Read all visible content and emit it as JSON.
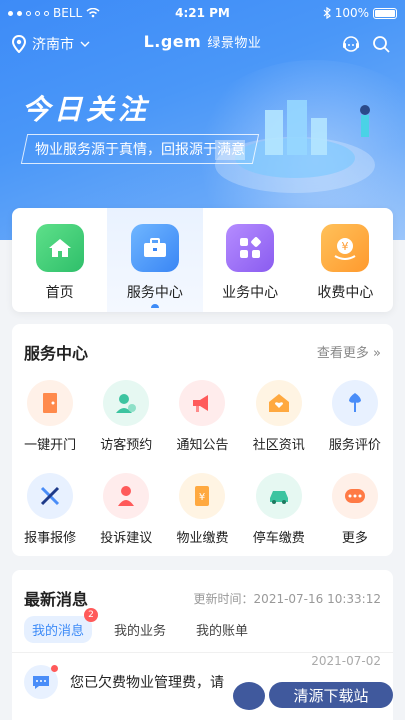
{
  "status": {
    "carrier": "BELL",
    "time": "4:21 PM",
    "battery": "100%"
  },
  "nav": {
    "city": "济南市",
    "logo_main": "L.gem",
    "logo_sub": "绿景物业"
  },
  "hero": {
    "title": "今日关注",
    "slogan": "物业服务源于真情，回报源于满意"
  },
  "tabs": [
    {
      "label": "首页",
      "icon": "home-icon",
      "active": false
    },
    {
      "label": "服务中心",
      "icon": "briefcase-icon",
      "active": true
    },
    {
      "label": "业务中心",
      "icon": "grid-icon",
      "active": false
    },
    {
      "label": "收费中心",
      "icon": "yuan-bag-icon",
      "active": false
    }
  ],
  "services": {
    "title": "服务中心",
    "more": "查看更多 »",
    "items": [
      {
        "label": "一键开门",
        "icon": "door-icon",
        "color": "#ff8a4c"
      },
      {
        "label": "访客预约",
        "icon": "visitor-icon",
        "color": "#3cc4a0"
      },
      {
        "label": "通知公告",
        "icon": "megaphone-icon",
        "color": "#ff5a5a"
      },
      {
        "label": "社区资讯",
        "icon": "house-heart-icon",
        "color": "#ffa940"
      },
      {
        "label": "服务评价",
        "icon": "flower-icon",
        "color": "#4a8df8"
      },
      {
        "label": "报事报修",
        "icon": "wrench-icon",
        "color": "#4a8df8"
      },
      {
        "label": "投诉建议",
        "icon": "complaint-icon",
        "color": "#ff5a5a"
      },
      {
        "label": "物业缴费",
        "icon": "bill-icon",
        "color": "#ffa940"
      },
      {
        "label": "停车缴费",
        "icon": "car-icon",
        "color": "#3cc4a0"
      },
      {
        "label": "更多",
        "icon": "more-icon",
        "color": "#ff7a45"
      }
    ]
  },
  "news": {
    "title": "最新消息",
    "update": "更新时间：2021-07-16  10:33:12",
    "tabs": [
      {
        "label": "我的消息",
        "badge": "2"
      },
      {
        "label": "我的业务"
      },
      {
        "label": "我的账单"
      }
    ],
    "message": {
      "text": "您已欠费物业管理费，请",
      "date": "2021-07-02"
    }
  },
  "watermark": "清源下载站"
}
